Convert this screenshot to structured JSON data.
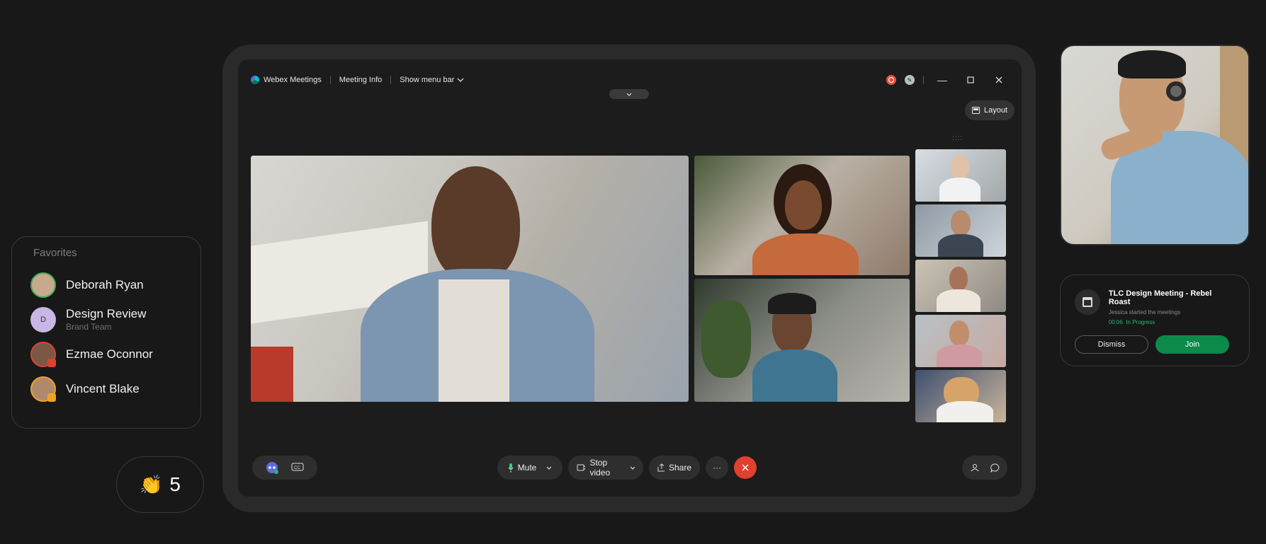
{
  "titlebar": {
    "app_name": "Webex Meetings",
    "meeting_info": "Meeting Info",
    "show_menu_bar": "Show menu bar"
  },
  "layout_button": "Layout",
  "controls": {
    "mute": "Mute",
    "stop_video": "Stop video",
    "share": "Share",
    "more": "···"
  },
  "favorites": {
    "title": "Favorites",
    "items": [
      {
        "name": "Deborah Ryan",
        "subtitle": "",
        "avatar_color": "#3fae5a"
      },
      {
        "name": "Design Review",
        "subtitle": "Brand Team",
        "initial": "D",
        "avatar_color": "#c9b6e4"
      },
      {
        "name": "Ezmae Oconnor",
        "subtitle": "",
        "avatar_color": "#d9432f"
      },
      {
        "name": "Vincent Blake",
        "subtitle": "",
        "avatar_color": "#f0a323"
      }
    ]
  },
  "reactions": {
    "clap_count": "5"
  },
  "meeting_card": {
    "title": "TLC Design Meeting - Rebel Roast",
    "subtitle": "Jessica started the meetings",
    "time": "00:06",
    "status": "In Progress",
    "dismiss": "Dismiss",
    "join": "Join"
  },
  "colors": {
    "background": "#181818",
    "end_call": "#e0402e",
    "join": "#0b8a4a",
    "recording": "#e5533d"
  }
}
